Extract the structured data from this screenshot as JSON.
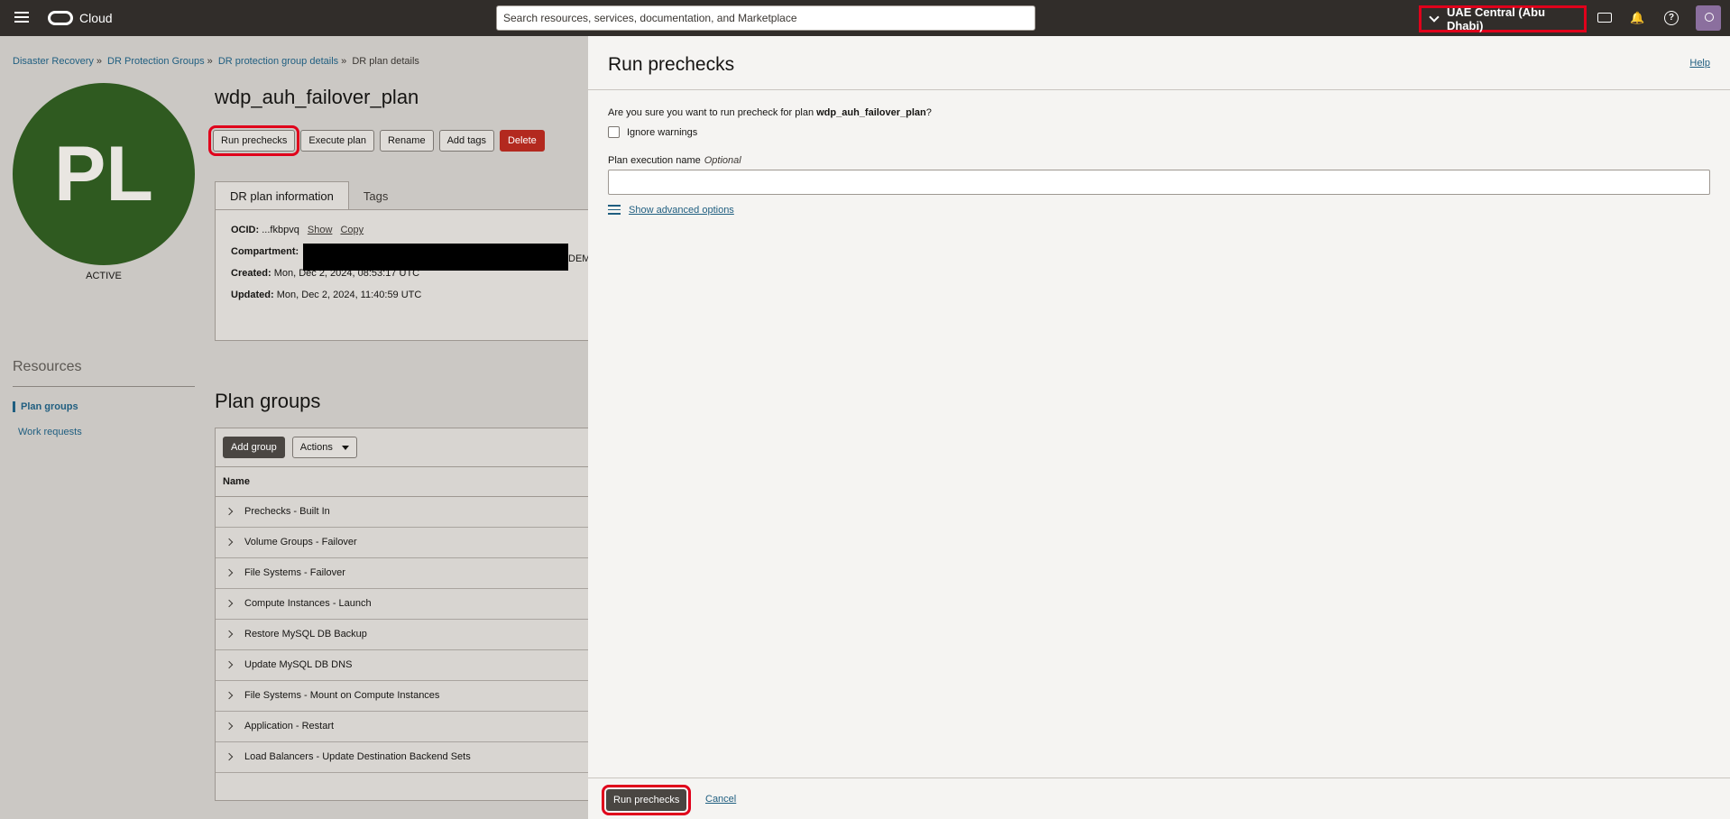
{
  "topbar": {
    "brand": "Cloud",
    "search_placeholder": "Search resources, services, documentation, and Marketplace",
    "region": "UAE Central (Abu Dhabi)",
    "help_glyph": "?"
  },
  "breadcrumb": {
    "items": [
      "Disaster Recovery",
      "DR Protection Groups",
      "DR protection group details",
      "DR plan details"
    ],
    "separator": "»"
  },
  "plan": {
    "avatar_initials": "PL",
    "avatar_color": "#2f5a20",
    "status": "ACTIVE",
    "name": "wdp_auh_failover_plan",
    "actions": {
      "run_prechecks": "Run prechecks",
      "execute_plan": "Execute plan",
      "rename": "Rename",
      "add_tags": "Add tags",
      "delete": "Delete"
    },
    "tabs": [
      "DR plan information",
      "Tags"
    ],
    "info": {
      "ocid_label": "OCID:",
      "ocid_value": "...fkbpvq",
      "show_link": "Show",
      "copy_link": "Copy",
      "compartment_label": "Compartment:",
      "compartment_tail": "DEM",
      "created_label": "Created:",
      "created_value": "Mon, Dec 2, 2024, 08:53:17 UTC",
      "updated_label": "Updated:",
      "updated_value": "Mon, Dec 2, 2024, 11:40:59 UTC"
    }
  },
  "resources": {
    "title": "Resources",
    "items": [
      "Plan groups",
      "Work requests"
    ]
  },
  "plan_groups": {
    "title": "Plan groups",
    "add_group": "Add group",
    "actions": "Actions",
    "column_name": "Name",
    "rows": [
      "Prechecks - Built In",
      "Volume Groups - Failover",
      "File Systems - Failover",
      "Compute Instances - Launch",
      "Restore MySQL DB Backup",
      "Update MySQL DB DNS",
      "File Systems - Mount on Compute Instances",
      "Application - Restart",
      "Load Balancers - Update Destination Backend Sets"
    ]
  },
  "drawer": {
    "title": "Run prechecks",
    "help": "Help",
    "confirm_prefix": "Are you sure you want to run precheck for plan ",
    "confirm_plan": "wdp_auh_failover_plan",
    "confirm_suffix": "?",
    "ignore_warnings": "Ignore warnings",
    "field_label": "Plan execution name",
    "field_optional": "Optional",
    "advanced": "Show advanced options",
    "submit": "Run prechecks",
    "cancel": "Cancel"
  },
  "colors": {
    "highlight": "#e0001b",
    "link": "#1f5e80",
    "delete": "#b3291f"
  }
}
